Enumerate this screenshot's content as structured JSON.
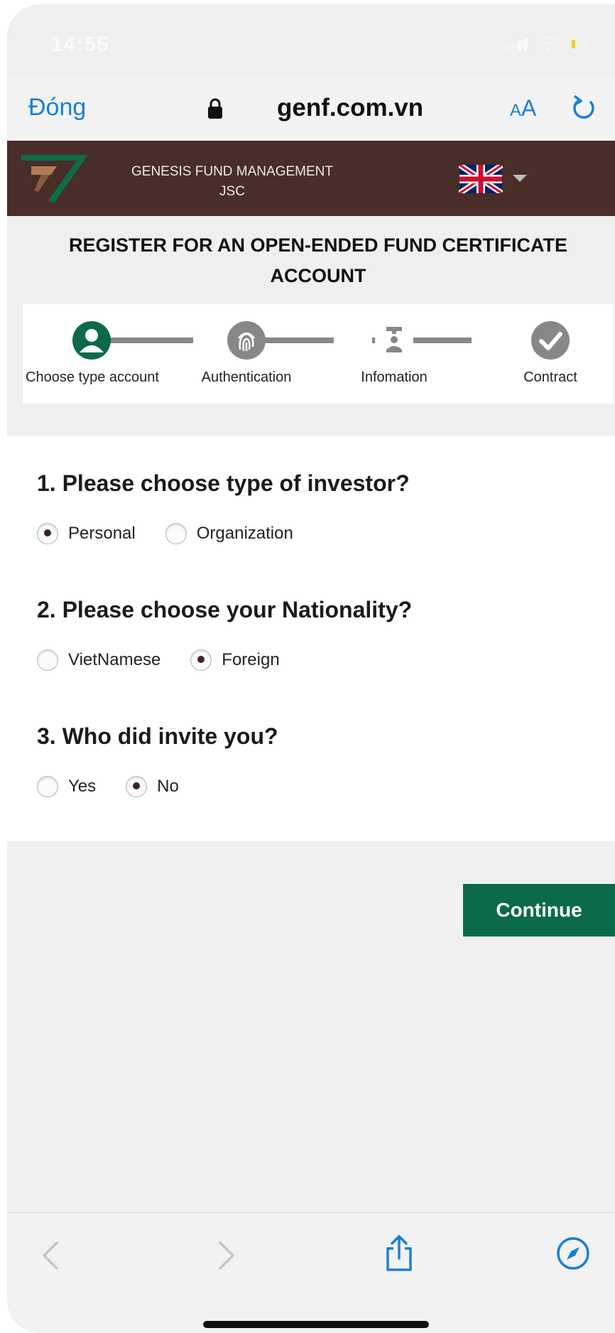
{
  "status_bar": {
    "time": "14:55"
  },
  "browser": {
    "done_label": "Đóng",
    "url": "genf.com.vn",
    "aa_small": "A",
    "aa_big": "A"
  },
  "site": {
    "company_line1": "GENESIS FUND MANAGEMENT",
    "company_line2": "JSC"
  },
  "page": {
    "title_line1": "REGISTER FOR AN OPEN-ENDED FUND CERTIFICATE",
    "title_line2": "ACCOUNT"
  },
  "stepper": {
    "steps": [
      {
        "label": "Choose type account",
        "icon": "person-icon",
        "active": true
      },
      {
        "label": "Authentication",
        "icon": "fingerprint-icon",
        "active": false
      },
      {
        "label": "Infomation",
        "icon": "info-person-icon",
        "active": false
      },
      {
        "label": "Contract",
        "icon": "check-icon",
        "active": false
      }
    ]
  },
  "form": {
    "q1": {
      "text": "1. Please choose type of investor?",
      "options": [
        {
          "label": "Personal",
          "checked": true
        },
        {
          "label": "Organization",
          "checked": false
        }
      ]
    },
    "q2": {
      "text": "2. Please choose your Nationality?",
      "options": [
        {
          "label": "VietNamese",
          "checked": false
        },
        {
          "label": "Foreign",
          "checked": true
        }
      ]
    },
    "q3": {
      "text": "3. Who did invite you?",
      "options": [
        {
          "label": "Yes",
          "checked": false
        },
        {
          "label": "No",
          "checked": true
        }
      ]
    }
  },
  "actions": {
    "continue_label": "Continue"
  },
  "colors": {
    "accent_blue": "#1a7fd4",
    "header_brown": "#482d28",
    "step_green": "#0b6a4a",
    "step_gray": "#878787",
    "continue_green": "#0b6a4a"
  }
}
